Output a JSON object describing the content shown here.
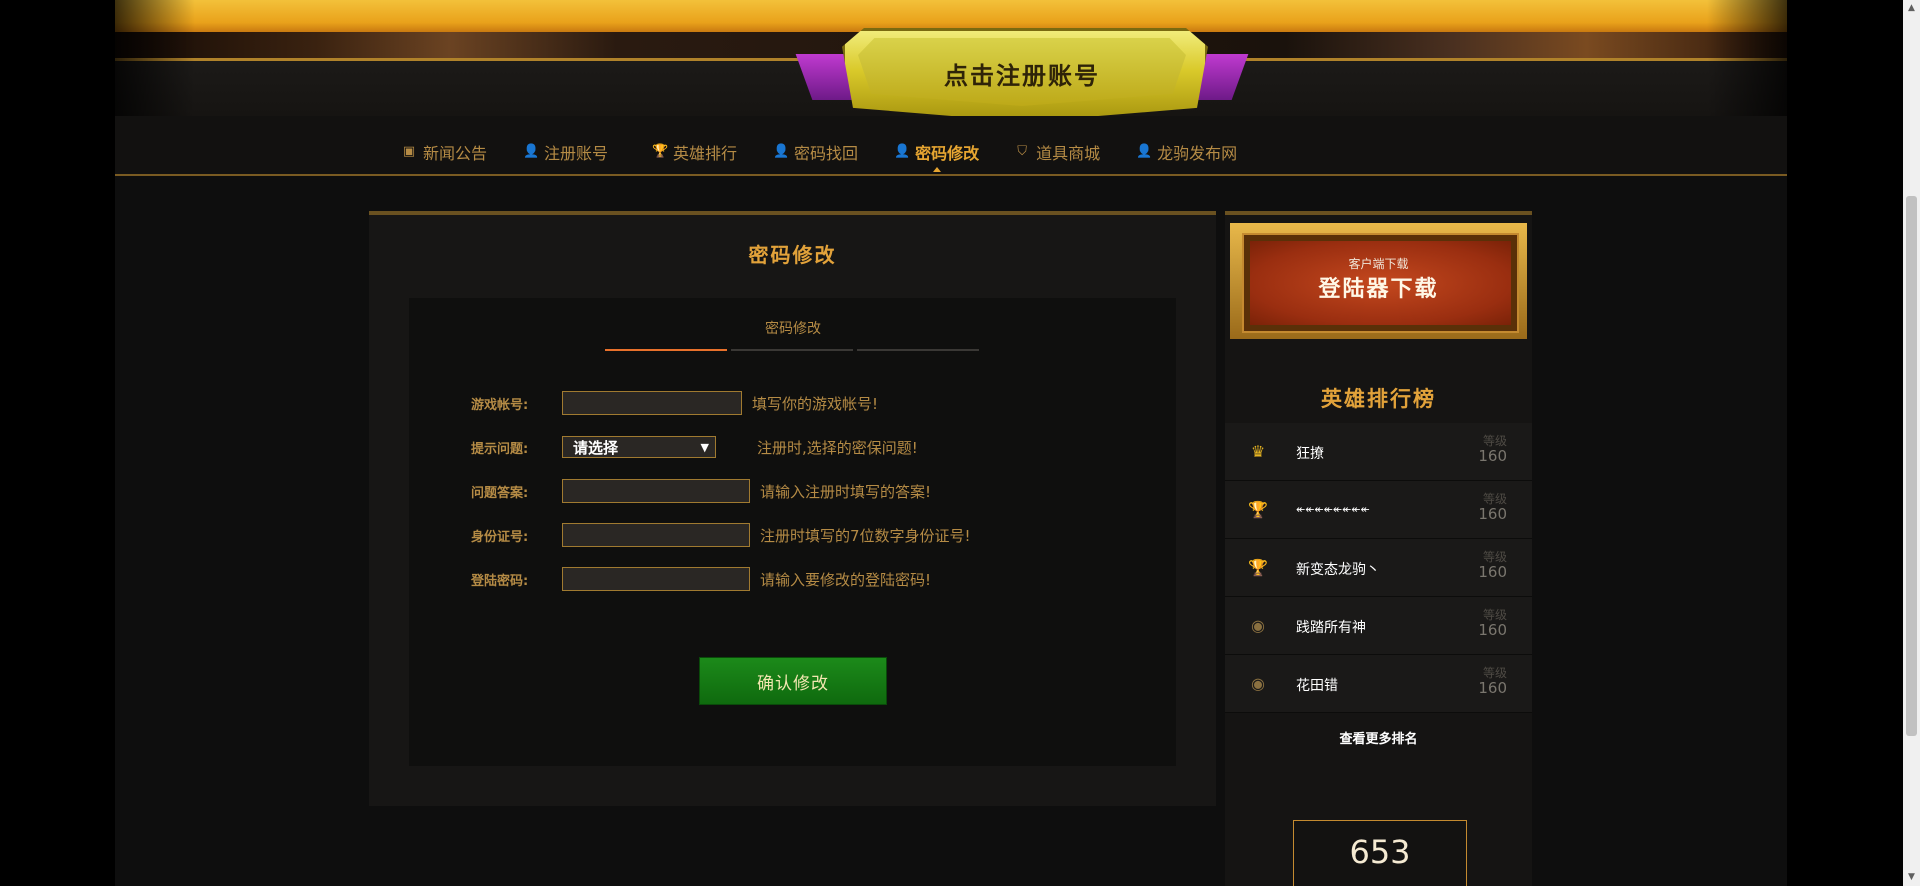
{
  "header": {
    "register_label": "点击注册账号"
  },
  "nav": {
    "items": [
      {
        "label": "新闻公告",
        "icon": "news-icon"
      },
      {
        "label": "注册账号",
        "icon": "user-add-icon"
      },
      {
        "label": "英雄排行",
        "icon": "trophy-icon"
      },
      {
        "label": "密码找回",
        "icon": "user-key-icon"
      },
      {
        "label": "密码修改",
        "icon": "user-icon",
        "active": true
      },
      {
        "label": "道具商城",
        "icon": "shield-icon"
      },
      {
        "label": "龙驹发布网",
        "icon": "user-key-icon"
      }
    ]
  },
  "main": {
    "title": "密码修改",
    "tab_label": "密码修改",
    "fields": [
      {
        "label": "游戏帐号:",
        "hint": "填写你的游戏帐号!"
      },
      {
        "label": "提示问题:",
        "hint": "注册时,选择的密保问题!",
        "select_value": "请选择"
      },
      {
        "label": "问题答案:",
        "hint": "请输入注册时填写的答案!"
      },
      {
        "label": "身份证号:",
        "hint": "注册时填写的7位数字身份证号!"
      },
      {
        "label": "登陆密码:",
        "hint": "请输入要修改的登陆密码!"
      }
    ],
    "confirm_label": "确认修改"
  },
  "sidebar": {
    "download_sub": "客户端下载",
    "download_main": "登陆器下载",
    "rank_title": "英雄排行榜",
    "level_label": "等级",
    "ranks": [
      {
        "name": "狂撩",
        "level": "160",
        "icon": "crown-icon",
        "icon_color": "#e6b422"
      },
      {
        "name": "↞↞↞↞↞↞↞↞",
        "level": "160",
        "icon": "silver-cup-icon",
        "icon_color": "#c8c8c8"
      },
      {
        "name": "新变态龙驹丶",
        "level": "160",
        "icon": "bronze-cup-icon",
        "icon_color": "#c8502a"
      },
      {
        "name": "践踏所有神",
        "level": "160",
        "icon": "medal-icon",
        "icon_color": "#8a7040"
      },
      {
        "name": "花田错",
        "level": "160",
        "icon": "medal-icon",
        "icon_color": "#8a7040"
      }
    ],
    "more_label": "查看更多排名",
    "counter_value": "653"
  },
  "colors": {
    "accent_gold": "#e2a23a",
    "label_gold": "#b58b45",
    "confirm_green": "#1c8a1a",
    "tab_active_line": "#e8712b"
  }
}
